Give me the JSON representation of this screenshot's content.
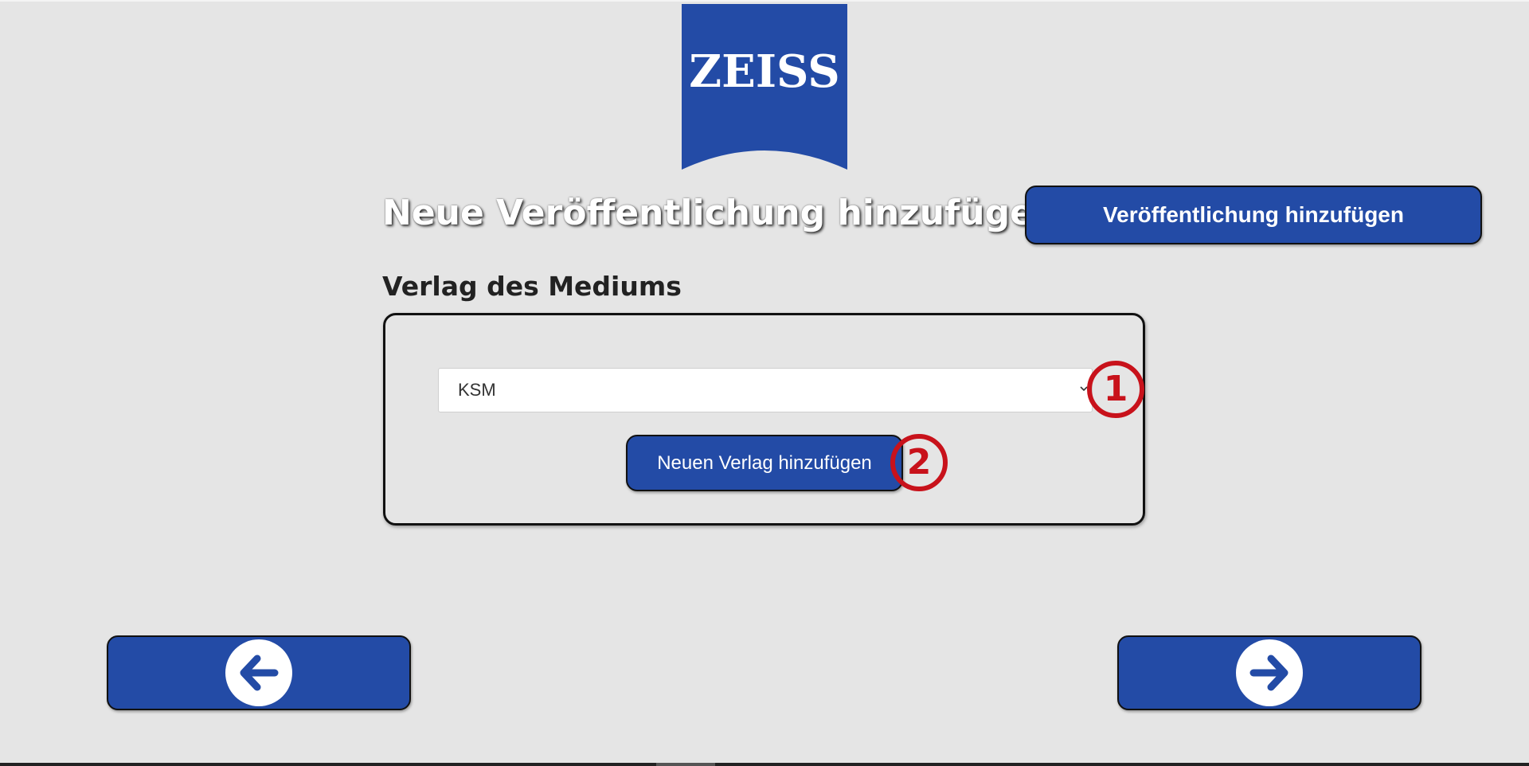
{
  "logo": {
    "text": "ZEISS",
    "color": "#234ba6"
  },
  "header": {
    "title": "Neue Veröffentlichung hinzufügen",
    "add_publication_label": "Veröffentlichung hinzufügen"
  },
  "publisher_section": {
    "label": "Verlag des Mediums",
    "select_value": "KSM",
    "add_publisher_label": "Neuen Verlag hinzufügen"
  },
  "annotations": {
    "marker_1": "1",
    "marker_2": "2",
    "color": "#c8121b"
  },
  "navigation": {
    "back_icon": "arrow-left-icon",
    "next_icon": "arrow-right-icon"
  },
  "colors": {
    "accent": "#234ba6",
    "background": "#e5e5e5"
  }
}
